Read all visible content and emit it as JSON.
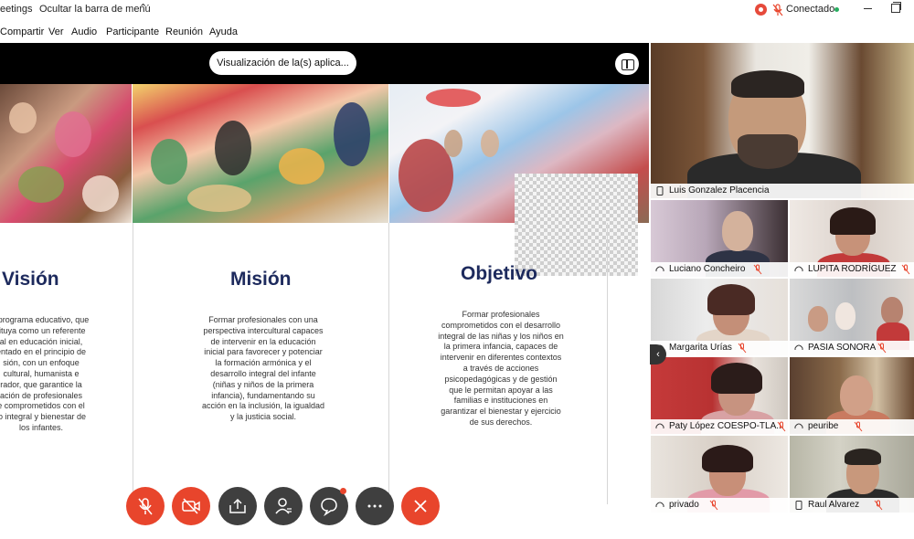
{
  "titlebar": {
    "app_title": "eetings",
    "hide_menu": "Ocultar la barra de menú",
    "status": "Conectado"
  },
  "menu": [
    "Compartir",
    "Ver",
    "Audio",
    "Participante",
    "Reunión",
    "Ayuda"
  ],
  "share": {
    "pill": "Visualización de la(s) aplica..."
  },
  "slide": {
    "columns": [
      {
        "title": "Visión",
        "text": "eprograma educativo, que\ntituya como un referente\nal en educación inicial,\nentado en el principio de\nsión, con un enfoque\ncultural, humanista e\nrador, que garantice la\nación de profesionales\ne comprometidos con el\nlo integral y bienestar de\nlos infantes."
      },
      {
        "title": "Misión",
        "text": "Formar profesionales con una\nperspectiva intercultural capaces\nde intervenir en la educación\ninicial para favorecer y potenciar\nla formación armónica y el\ndesarrollo integral del infante\n(niñas y niños de la primera\ninfancia), fundamentando su\nacción en la inclusión, la igualdad\ny la justicia social."
      },
      {
        "title": "Objetivo",
        "text": "Formar profesionales\ncomprometidos con el desarrollo\nintegral de las niñas y los niños en\nla primera infancia, capaces de\nintervenir en diferentes contextos\na través de acciones\npsicopedagógicas y de gestión\nque le permitan apoyar a las\nfamilias e instituciones en\ngarantizar el bienestar y ejercicio\nde sus derechos."
      }
    ]
  },
  "participants": {
    "main": "Luis Gonzalez Placencia",
    "grid": [
      "Luciano Concheiro",
      "LUPITA RODRÍGUEZ",
      "Margarita Urías",
      "PASIA SONORA",
      "Paty López COESPO-TLA...",
      "peuribe",
      "privado",
      "Raul Alvarez"
    ]
  },
  "colors": {
    "accent_red": "#e8452c",
    "title_navy": "#1d2a5d",
    "control_dark": "#3f3f3f",
    "connected_green": "#27ae60"
  },
  "icons": [
    "record-icon",
    "mic-muted-icon",
    "video-muted-icon",
    "share-screen-icon",
    "participants-icon",
    "chat-icon",
    "more-icon",
    "leave-icon",
    "layout-icon",
    "headset-icon",
    "phone-icon"
  ]
}
